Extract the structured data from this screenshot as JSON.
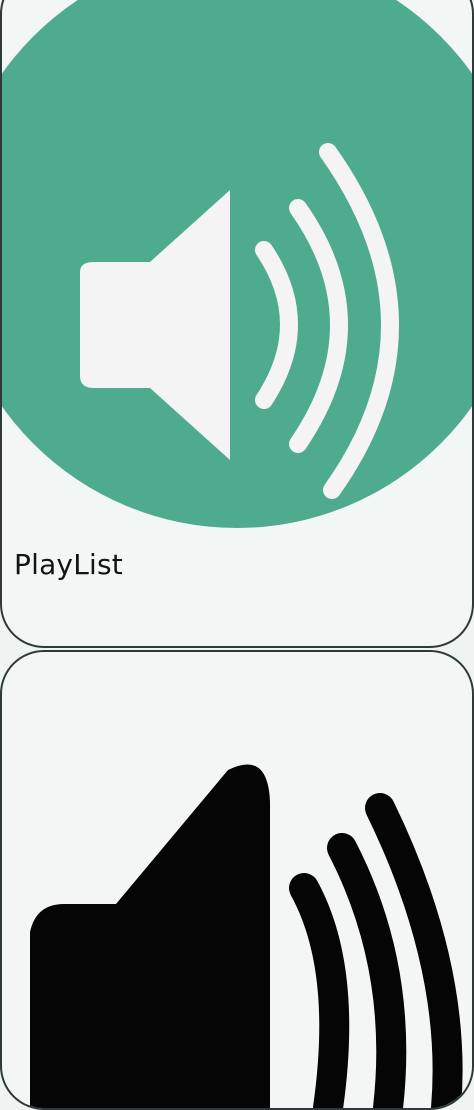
{
  "playlists": [
    {
      "title": "PlayList",
      "icon": "speaker-volume-icon",
      "icon_bg_color": "#4fab8e",
      "icon_fg_color": "#f4f4f4"
    },
    {
      "title": "",
      "icon": "speaker-volume-icon",
      "icon_bg_color": "#f4f6f6",
      "icon_fg_color": "#050505"
    }
  ]
}
